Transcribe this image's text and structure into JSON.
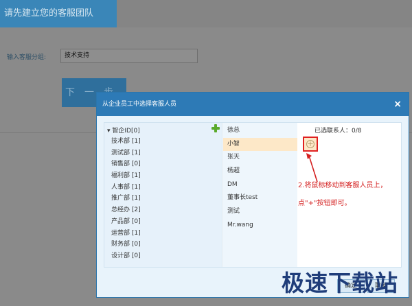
{
  "background_page": {
    "title": "请先建立您的客服团队",
    "group_label": "输入客服分组:",
    "group_value": "技术支持",
    "next_button": "下一步"
  },
  "dialog": {
    "title": "从企业员工中选择客服人员",
    "close_glyph": "×",
    "tree": {
      "root": "▾ 智企ID[0]",
      "departments": [
        "技术部 [1]",
        "测试部 [1]",
        "销售部 [0]",
        "福利部 [1]",
        "人事部 [1]",
        "推广部 [1]",
        "总经办 [2]",
        "产品部 [0]",
        "运营部 [1]",
        "财务部 [0]",
        "设计部 [0]"
      ]
    },
    "staff": [
      "徐总",
      "小智",
      "张天",
      "杨超",
      "DM",
      "董事长test",
      "测试",
      "Mr.wang"
    ],
    "selected_label": "已选联系人：0/8",
    "add_glyph": "+",
    "confirm_button": "确定",
    "cancel_button": "取消"
  },
  "annotation": {
    "line1": "2.将鼠标移动到客服人员上，",
    "line2": "点\"+\"按钮即可。"
  },
  "watermark": "极速下载站",
  "colors": {
    "dialog_header": "#2d7ab6",
    "highlight_row": "#fde8c8",
    "annotation_red": "#d42020",
    "add_green": "#5aaa2a"
  }
}
